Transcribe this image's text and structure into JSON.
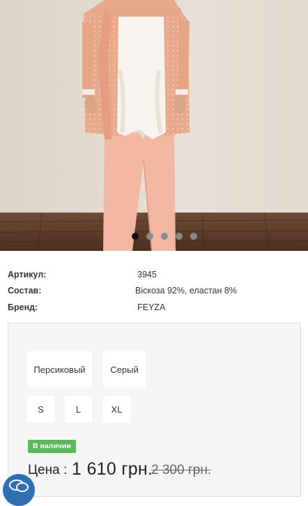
{
  "gallery": {
    "slides": 5,
    "active_index": 0
  },
  "attributes": [
    {
      "label": "Артикул:",
      "value": "3945"
    },
    {
      "label": "Состав:",
      "value": "Віскоза 92%, еластан 8%"
    },
    {
      "label": "Бренд:",
      "value": "FEYZA"
    }
  ],
  "options": {
    "colors": [
      "Персиковый",
      "Серый"
    ],
    "sizes": [
      "S",
      "L",
      "XL"
    ]
  },
  "availability": "В наличии",
  "price": {
    "label": "Цена :",
    "current": "1 610 грн.",
    "old": "2 300 грн."
  },
  "colors": {
    "in_stock": "#5cb85c",
    "chat": "#2f6fb3",
    "active_dot": "#111111",
    "inactive_dot": "#8a8a8a"
  }
}
